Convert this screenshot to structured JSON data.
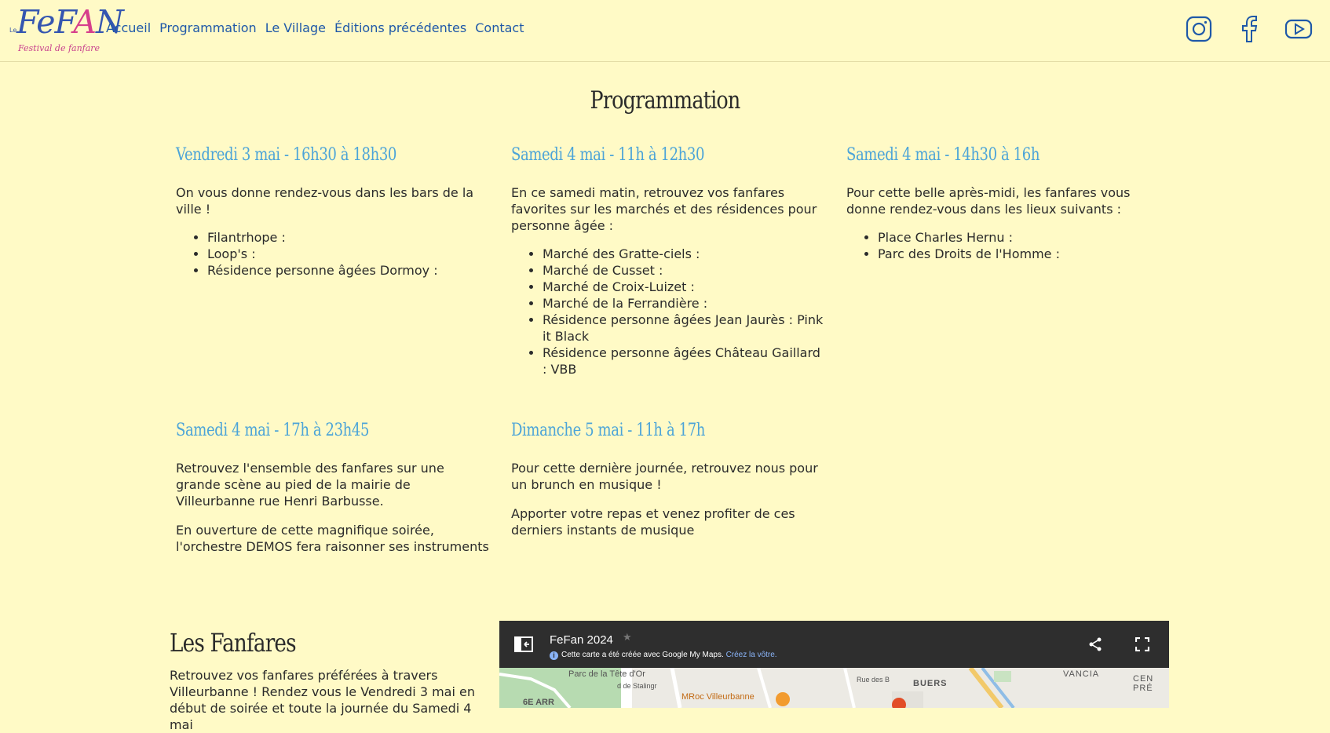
{
  "logo": {
    "prefix": "Le",
    "name_start": "FeF",
    "name_accent": "A",
    "name_end": "N",
    "tagline": "Festival de fanfare"
  },
  "nav": {
    "items": [
      "Accueil",
      "Programmation",
      "Le Village",
      "Éditions précédentes",
      "Contact"
    ]
  },
  "social": {
    "icons": [
      "instagram-icon",
      "facebook-icon",
      "youtube-icon"
    ],
    "color": "#1f58a8"
  },
  "programmation": {
    "title": "Programmation",
    "days": [
      {
        "title": "Vendredi 3 mai - 16h30 à 18h30",
        "paragraphs": [
          "On vous donne rendez-vous dans les bars de la ville !"
        ],
        "items": [
          "Filantrhope :",
          "Loop's :",
          "Résidence personne âgées Dormoy :"
        ]
      },
      {
        "title": "Samedi 4 mai - 11h à 12h30",
        "paragraphs": [
          "En ce samedi matin, retrouvez vos fanfares favorites sur les marchés et des résidences pour personne âgée :"
        ],
        "items": [
          "Marché des Gratte-ciels :",
          "Marché de Cusset :",
          "Marché de Croix-Luizet :",
          "Marché de la Ferrandière :",
          "Résidence personne âgées Jean Jaurès : Pink it Black",
          "Résidence personne âgées Château Gaillard : VBB"
        ]
      },
      {
        "title": "Samedi 4 mai - 14h30 à 16h",
        "paragraphs": [
          "Pour cette belle après-midi, les fanfares vous donne rendez-vous dans les lieux suivants :"
        ],
        "items": [
          "Place Charles Hernu :",
          "Parc des Droits de l'Homme :"
        ]
      },
      {
        "title": "Samedi 4 mai - 17h à 23h45",
        "paragraphs": [
          "Retrouvez l'ensemble des fanfares sur une grande scène au pied de la mairie de Villeurbanne rue Henri Barbusse.",
          "En ouverture de cette magnifique soirée, l'orchestre DEMOS fera raisonner ses instruments"
        ],
        "items": []
      },
      {
        "title": "Dimanche 5 mai - 11h à 17h",
        "paragraphs": [
          "Pour cette dernière journée, retrouvez nous pour un brunch en musique !",
          "Apporter votre repas et venez profiter de ces derniers instants de musique"
        ],
        "items": []
      }
    ]
  },
  "fanfares": {
    "title": "Les Fanfares",
    "text": "Retrouvez vos fanfares préférées à travers Villeurbanne ! Rendez vous le Vendredi 3 mai en début de soirée et toute la journée du Samedi 4 mai"
  },
  "map": {
    "title": "FeFan 2024",
    "info": "Cette carte a été créée avec Google My Maps.",
    "link": "Créez la vôtre.",
    "labels": [
      "Parc de la Tête d'Or",
      "6E ARR",
      "MRoc Villeurbanne",
      "Rue des B",
      "BUERS",
      "VANCIA",
      "CEN PRÉ",
      "d de Stalingr"
    ]
  },
  "colors": {
    "background": "#fffac6",
    "heading_blue": "#4ca4d8",
    "nav_blue": "#1f58a8",
    "map_bar": "#2e2e2e"
  }
}
